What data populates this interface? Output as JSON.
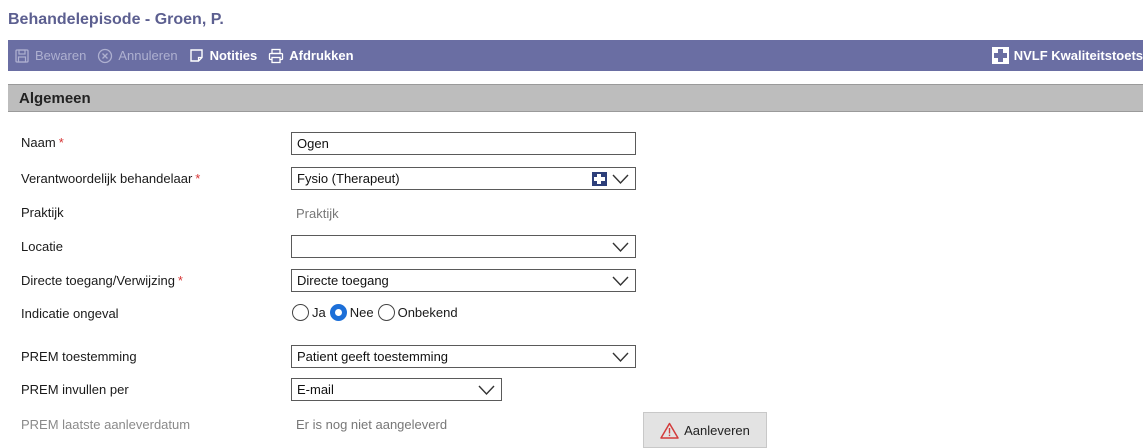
{
  "page_title": "Behandelepisode - Groen, P.",
  "toolbar": {
    "save_label": "Bewaren",
    "cancel_label": "Annuleren",
    "notes_label": "Notities",
    "print_label": "Afdrukken",
    "quality_label": "NVLF Kwaliteitstoets",
    "bar_color": "#6a6ea3"
  },
  "section": {
    "title": "Algemeen"
  },
  "form": {
    "required_mark": "*",
    "naam": {
      "label": "Naam",
      "value": "Ogen"
    },
    "behandelaar": {
      "label": "Verantwoordelijk behandelaar",
      "value": "Fysio (Therapeut)"
    },
    "praktijk": {
      "label": "Praktijk",
      "value": "Praktijk"
    },
    "locatie": {
      "label": "Locatie",
      "value": ""
    },
    "toegang": {
      "label": "Directe toegang/Verwijzing",
      "value": "Directe toegang"
    },
    "ongeval": {
      "label": "Indicatie ongeval",
      "options": [
        "Ja",
        "Nee",
        "Onbekend"
      ],
      "selected": "Nee"
    },
    "prem_toestemming": {
      "label": "PREM toestemming",
      "value": "Patient geeft toestemming"
    },
    "prem_invullen": {
      "label": "PREM invullen per",
      "value": "E-mail"
    },
    "prem_datum": {
      "label": "PREM laatste aanleverdatum",
      "value": "Er is nog niet aangeleverd"
    },
    "submit_label": "Aanleveren"
  }
}
